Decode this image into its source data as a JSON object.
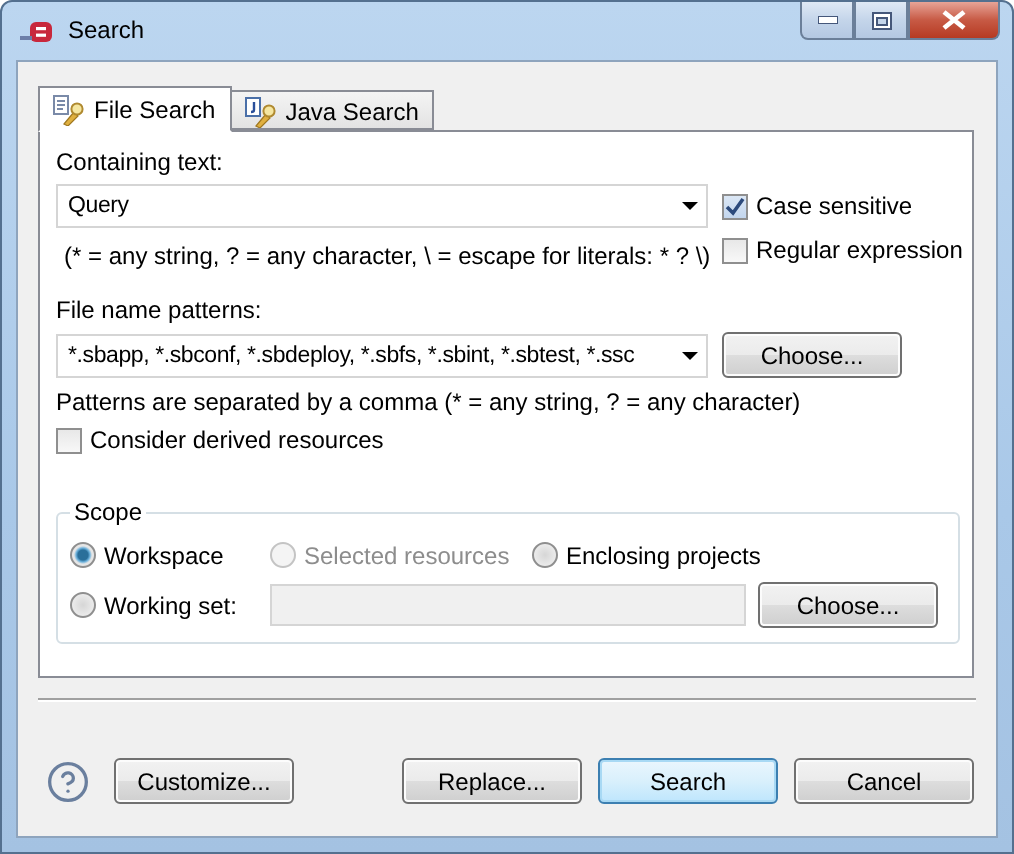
{
  "window": {
    "title": "Search"
  },
  "tabs": [
    {
      "label": "File Search",
      "selected": true
    },
    {
      "label": "Java Search",
      "selected": false
    }
  ],
  "containing_text": {
    "label": "Containing text:",
    "value": "Query",
    "hint": "(* = any string, ? = any character, \\ = escape for literals: * ? \\)"
  },
  "options": [
    {
      "label": "Case sensitive",
      "checked": true
    },
    {
      "label": "Regular expression",
      "checked": false
    }
  ],
  "file_name_patterns": {
    "label": "File name patterns:",
    "value": "*.sbapp, *.sbconf, *.sbdeploy, *.sbfs, *.sbint, *.sbtest, *.ssc",
    "choose_button": "Choose...",
    "hint": "Patterns are separated by a comma (* = any string, ? = any character)"
  },
  "consider_derived": {
    "label": "Consider derived resources",
    "checked": false
  },
  "scope": {
    "title": "Scope",
    "options": [
      {
        "label": "Workspace",
        "selected": true,
        "disabled": false
      },
      {
        "label": "Selected resources",
        "selected": false,
        "disabled": true
      },
      {
        "label": "Enclosing projects",
        "selected": false,
        "disabled": false
      },
      {
        "label": "Working set:",
        "selected": false,
        "disabled": false
      }
    ],
    "working_set_field": {
      "disabled": true
    },
    "choose_button": "Choose..."
  },
  "left_buttons": [
    "Customize..."
  ],
  "buttons": [
    {
      "label": "Replace...",
      "default": false
    },
    {
      "label": "Search",
      "default": true
    },
    {
      "label": "Cancel",
      "default": false
    }
  ]
}
